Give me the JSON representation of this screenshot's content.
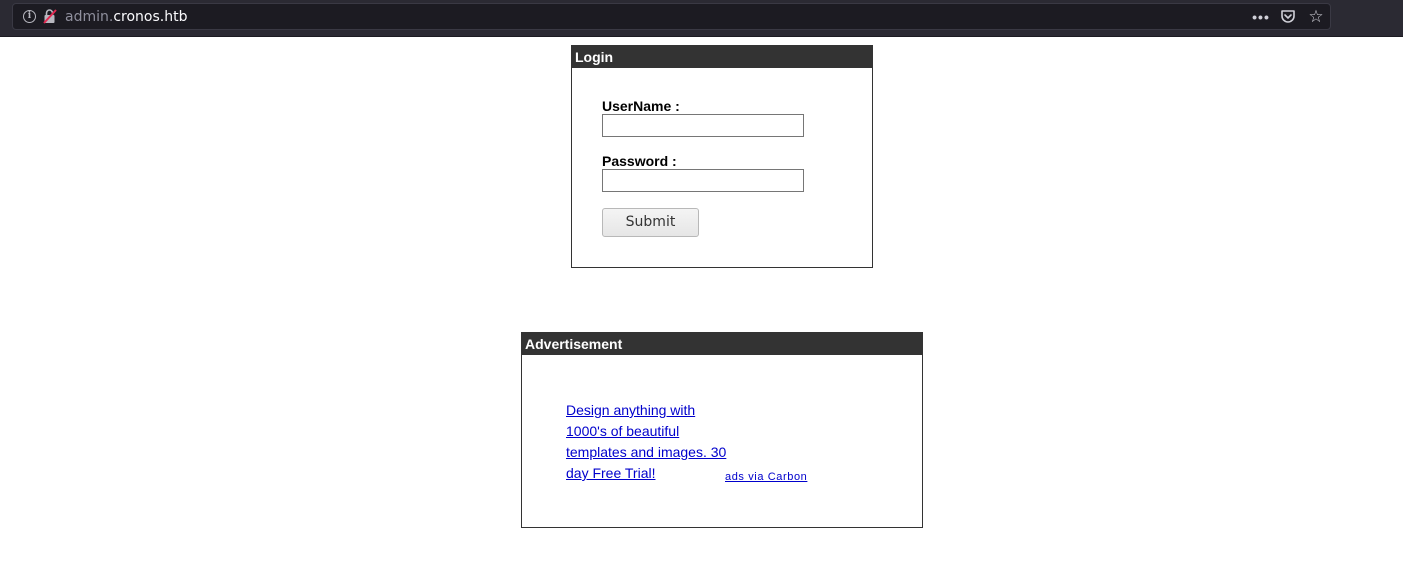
{
  "browser": {
    "url_subdomain": "admin.",
    "url_domain": "cronos.htb",
    "icons": [
      "info-icon",
      "insecure-lock-icon",
      "more-actions-icon",
      "pocket-icon",
      "bookmark-star-icon"
    ]
  },
  "login": {
    "header": "Login",
    "username_label": "UserName :",
    "username_value": "",
    "password_label": "Password :",
    "password_value": "",
    "submit_label": "Submit"
  },
  "advertisement": {
    "header": "Advertisement",
    "ad_text": "Design anything with 1000's of beautiful templates and images. 30 day Free Trial!",
    "credit": "ads via Carbon"
  },
  "colors": {
    "header_bg": "#333333",
    "header_text": "#ffffff",
    "link": "#0000cc"
  }
}
